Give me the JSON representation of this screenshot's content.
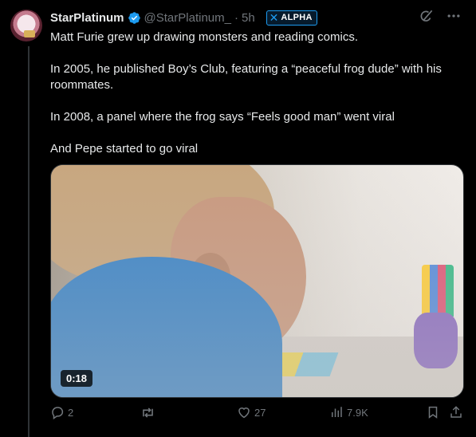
{
  "author": {
    "name": "StarPlatinum",
    "handle": "@StarPlatinum_",
    "separator": "·",
    "time": "5h",
    "badge_label": "ALPHA"
  },
  "tweet": {
    "paragraphs": [
      "Matt Furie grew up drawing monsters and reading comics.",
      "In 2005, he published Boy’s Club, featuring a “peaceful frog dude” with his roommates.",
      "In 2008, a panel where the frog says “Feels good man” went viral",
      "And Pepe started to go viral"
    ]
  },
  "media": {
    "duration": "0:18"
  },
  "stats": {
    "replies": "2",
    "reposts": "",
    "likes": "27",
    "views": "7.9K"
  },
  "colors": {
    "accent": "#1d9bf0",
    "muted": "#71767b",
    "text": "#e7e9ea",
    "background": "#000000"
  },
  "icons": {
    "verified": "verified-badge-icon",
    "grok": "grok-icon",
    "more": "more-icon",
    "reply": "reply-icon",
    "repost": "repost-icon",
    "like": "heart-icon",
    "views": "views-icon",
    "bookmark": "bookmark-icon",
    "share": "share-icon"
  }
}
